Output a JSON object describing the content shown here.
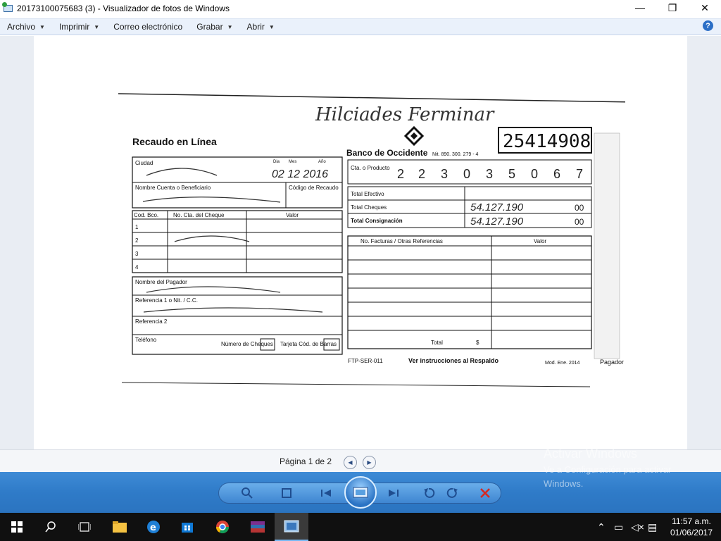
{
  "window": {
    "title": "20173100075683 (3) - Visualizador de fotos de Windows",
    "minimize": "—",
    "maximize": "❐",
    "close": "✕"
  },
  "menu": {
    "items": [
      {
        "label": "Archivo",
        "caret": true
      },
      {
        "label": "Imprimir",
        "caret": true
      },
      {
        "label": "Correo electrónico",
        "caret": false
      },
      {
        "label": "Grabar",
        "caret": true
      },
      {
        "label": "Abrir",
        "caret": true
      }
    ],
    "help": "?"
  },
  "document": {
    "handwritten_top": "Hilciades Ferminar",
    "recaudo": "Recaudo en Línea",
    "bank": "Banco de Occidente",
    "nit": "Nit. 890. 300. 279 - 4",
    "voucher_number": "25414908",
    "ciudad_label": "Ciudad",
    "dia": "Dia",
    "mes": "Mes",
    "ano": "Año",
    "date_hand": "02 12 2016",
    "cta_label": "Cta. o Producto",
    "cta_digits": [
      "2",
      "2",
      "3",
      "0",
      "3",
      "5",
      "0",
      "6",
      "7"
    ],
    "nombre_cuenta_label": "Nombre Cuenta o Beneficiario",
    "codigo_recaudo_label": "Código de Recaudo",
    "total_efectivo": "Total Efectivo",
    "total_cheques": "Total Cheques",
    "total_cheques_val": "54.127.190",
    "total_consignacion": "Total Consignación",
    "total_consignacion_val": "54.127.190",
    "cents": "00",
    "cod_bco": "Cod. Bco.",
    "no_cta_cheque": "No. Cta. del Cheque",
    "valor": "Valor",
    "rows": [
      "1",
      "2",
      "3",
      "4"
    ],
    "facturas": "No. Facturas / Otras Referencias",
    "nombre_pagador_label": "Nombre del Pagador",
    "referencia1_label": "Referencia 1 o Nit. / C.C.",
    "referencia2_label": "Referencia 2",
    "telefono_label": "Teléfono",
    "numero_cheques": "Número de Cheques",
    "tarjeta_cod": "Tarjeta Cód. de Barras",
    "total_label": "Total",
    "dollar": "$",
    "form_code": "FTP-SER-011",
    "ver_instrucciones": "Ver instrucciones al Respaldo",
    "mod": "Mod. Ene. 2014",
    "pagador": "Pagador"
  },
  "page_nav": {
    "label": "Página 1 de 2",
    "prev": "◀",
    "next": "▶"
  },
  "activation": {
    "title": "Activar Windows",
    "subtitle": "Ve a Configuración para activar Windows."
  },
  "taskbar": {
    "time": "11:57 a.m.",
    "date": "01/06/2017"
  },
  "colors": {
    "toolbar": "#2f7bc8",
    "menubar": "#eaf1fb",
    "taskbar": "#101010",
    "delete_red": "#d7261e"
  }
}
